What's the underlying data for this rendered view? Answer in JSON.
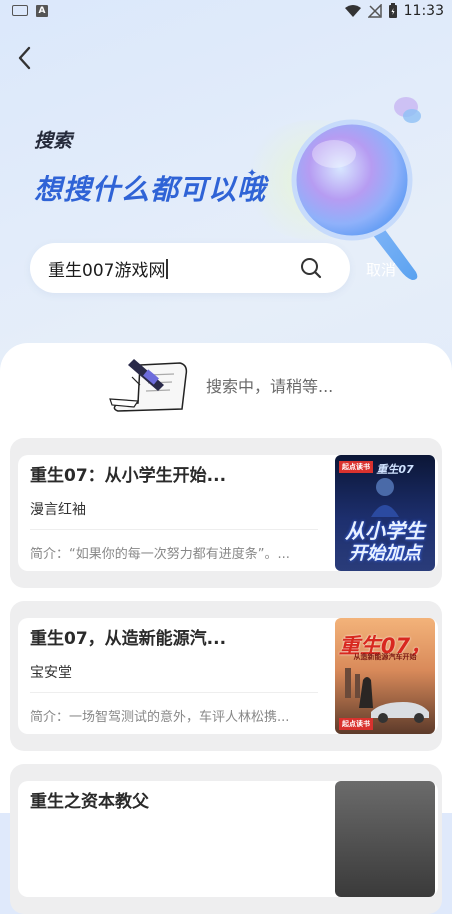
{
  "status_bar": {
    "time": "11:33"
  },
  "header": {
    "title_small": "搜索",
    "title_big": "想搜什么都可以哦"
  },
  "search": {
    "value": "重生007游戏网",
    "cancel_label": "取消"
  },
  "loading": {
    "text": "搜索中，请稍等..."
  },
  "results": [
    {
      "title": "重生07：从小学生开始...",
      "author": "漫言红袖",
      "intro": "简介：“如果你的每一次努力都有进度条”。...",
      "cover": {
        "badge": "起点读书",
        "line1": "重生07",
        "line2": "从小学生",
        "line3": "开始加点",
        "colors": [
          "#0b1636",
          "#2a3c7a"
        ]
      }
    },
    {
      "title": "重生07，从造新能源汽...",
      "author": "宝安堂",
      "intro": "简介：一场智驾测试的意外，车评人林松携...",
      "cover": {
        "badge": "起点读书",
        "line1": "重生07，",
        "line2": "从造新能源汽车开始",
        "colors": [
          "#f0a86a",
          "#5c3a2a"
        ]
      }
    },
    {
      "title": "重生之资本教父",
      "author": "",
      "intro": "",
      "cover": {
        "badge": "",
        "line1": "",
        "line2": "",
        "colors": [
          "#5b5b5b",
          "#2a2a2a"
        ]
      }
    }
  ]
}
